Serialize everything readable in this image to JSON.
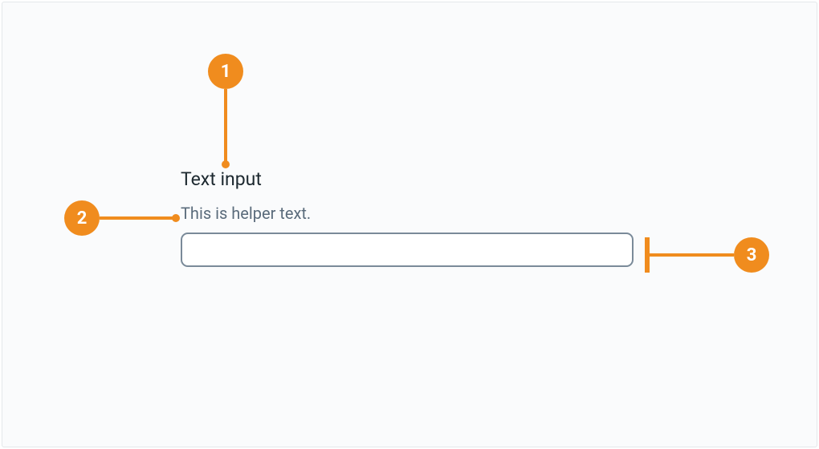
{
  "field": {
    "label": "Text input",
    "helper_text": "This is helper text.",
    "value": "",
    "placeholder": ""
  },
  "annotations": {
    "1": "1",
    "2": "2",
    "3": "3"
  },
  "colors": {
    "annotation": "#f08c1e",
    "label": "#1d2930",
    "helper": "#5a6b7b",
    "input_border": "#7a8a99",
    "page_bg": "#fafbfc"
  }
}
